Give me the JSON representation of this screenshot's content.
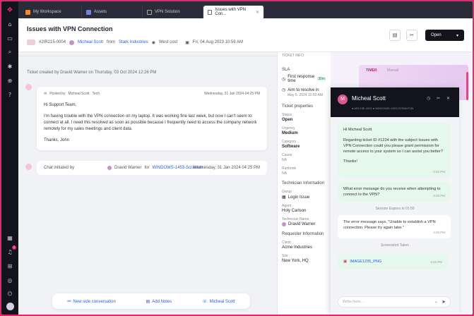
{
  "tabs": [
    {
      "label": "My Workspace"
    },
    {
      "label": "Assets"
    },
    {
      "label": "VPN Solution"
    },
    {
      "label": "Issues with VPN Con..."
    }
  ],
  "header": {
    "title": "Issues with VPN Connection",
    "ticket_id": "#2IR215-0004",
    "requester": "Micheal Scott",
    "from_label": "from",
    "company": "Stark Industries",
    "location": "West cost",
    "date": "Fri, 04 Aug 2023 10:59 AM",
    "open_label": "Open"
  },
  "main": {
    "created_line": "Ticket created by Dravid Warner on Thursday, 03 Oct 2024 12:26 PM",
    "email": {
      "posted_by": "Posted by",
      "author": "Micheal Scott",
      "author_suffix": "Tech",
      "time": "Wednesday, 31 Jan 2024 04:25 PM",
      "greeting": "Hi Support Team,",
      "body": "I'm having trouble with the VPN connection on my laptop. It was working fine last week, but now I can't seem to connect at all. I need this resolved as soon as possible because I frequently need to access the company network remotely for my sales meetings and client data.",
      "signoff": "Thanks, John"
    },
    "chat_init": {
      "text": "Chat initiated by",
      "agent": "Dravid Warner",
      "for_label": "for",
      "device": "WINDOWS-1453-Scranton",
      "time": "Wednesday, 31 Jan 2024 04:25 PM"
    },
    "actions": {
      "new_side": "New side conversation",
      "add_notes": "Add Notes",
      "contact": "Micheal Scott"
    }
  },
  "props": {
    "header": "TICKET INFO",
    "sla": "SLA",
    "first_response": "First response time",
    "first_response_val": "30m",
    "aim_resolve": "Aim to resolve in",
    "aim_date": "May 5, 2024 10:50 AM",
    "ticket_properties": "Ticket properties",
    "status_label": "Status",
    "status_val": "Open",
    "urgency_label": "Urgency",
    "urgency_val": "Medium",
    "category_label": "Category",
    "category_val": "Software",
    "cause_label": "Cause",
    "cause_val": "NA",
    "runbook_label": "Runbook",
    "runbook_val": "NA",
    "tech_info": "Technician Information",
    "group_label": "Group",
    "group_val": "Login Issue",
    "agent_label": "Agent",
    "agent_val": "Holy Carlson",
    "techname_label": "Technician Name",
    "techname_val": "Dravid Warner",
    "req_info": "Requester Information",
    "client_label": "Client",
    "client_val": "Acme Industries",
    "site_label": "Site",
    "site_val": "New York, HQ"
  },
  "timer": {
    "label": "TIMER",
    "sub": "Manual"
  },
  "chat": {
    "name": "Micheal Scott",
    "initial": "M",
    "sub": "● ARCHIE-0001  ● WINDOWS-1453-SCRANTON",
    "msg1_greet": "Hi Micheal Scott",
    "msg1_body": "Regarding ticket ID #1234 with the subject Issues with VPN Connection could you please grant permission for remote access to your system so I can assist you better?",
    "msg1_thanks": "Thanks!",
    "msg1_time": "3:45 PM",
    "msg2": "What error message do you receive when attempting to connect to the VPN?",
    "msg2_time": "3:45 PM",
    "session": "Session Expires in 01:59",
    "msg3": "The error message says, \"Unable to establish a VPN connection. Please try again later.\"",
    "msg3_time": "3:45 PM",
    "screenshot": "Screenshot Taken",
    "image_name": "IMAGE1235_PNG",
    "image_time": "3:42 PM",
    "placeholder": "Write here..."
  }
}
